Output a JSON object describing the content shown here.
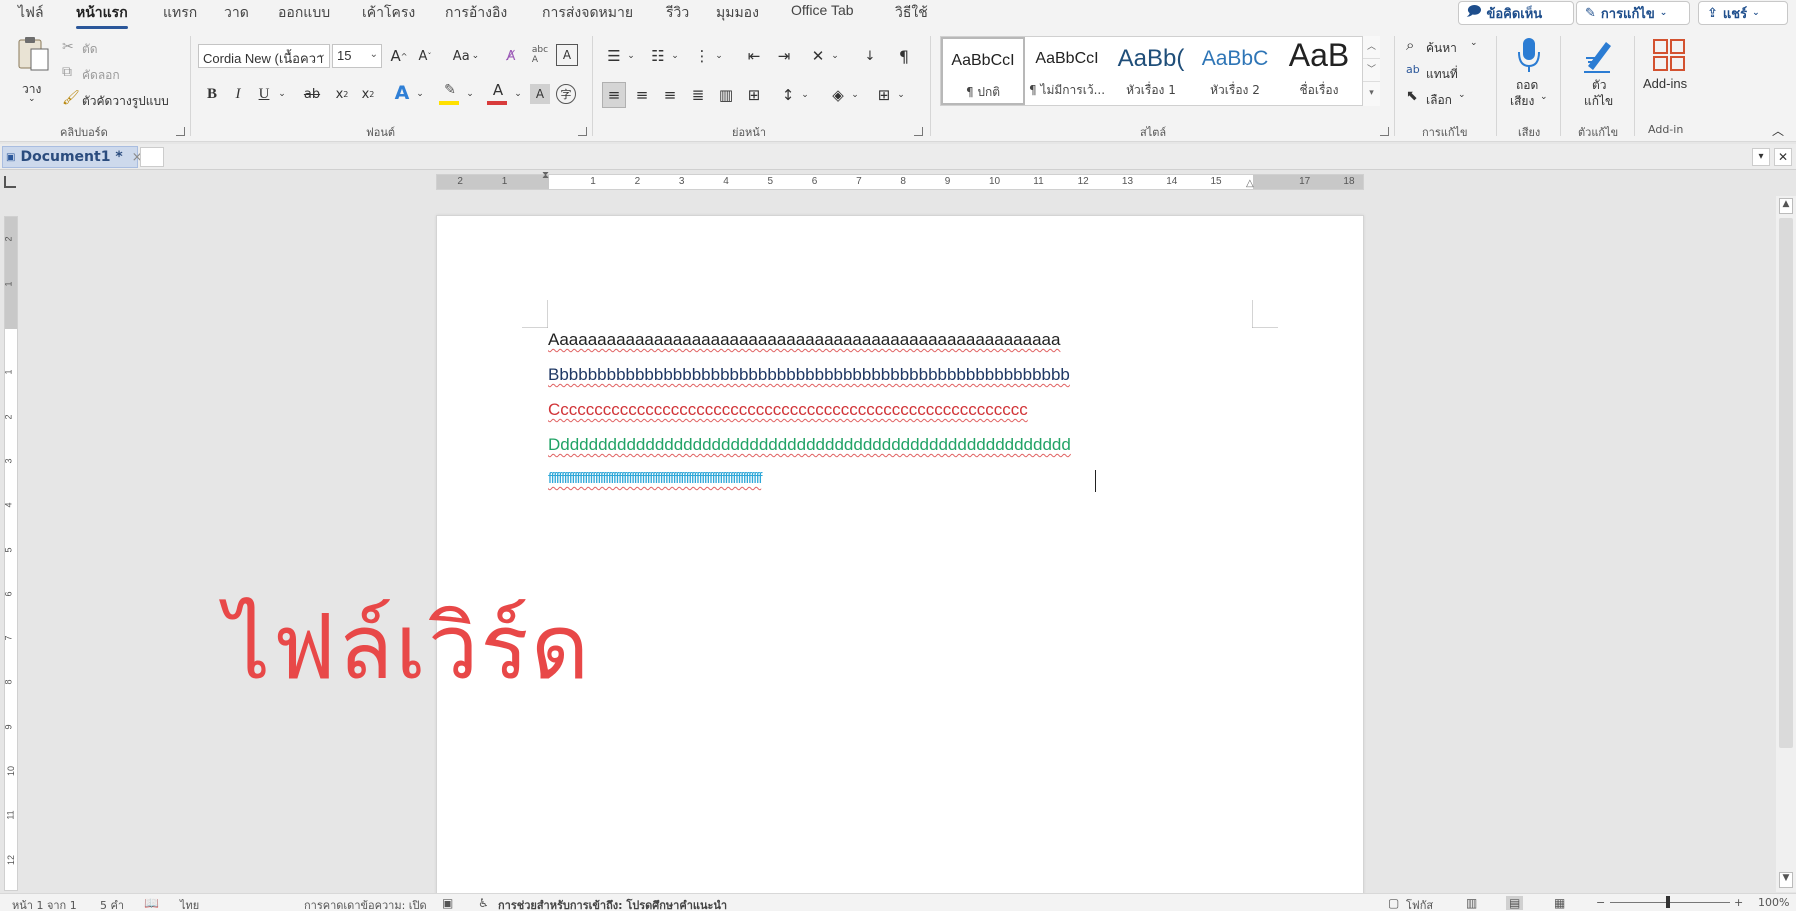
{
  "menubar": {
    "tabs": [
      "ไฟล์",
      "หน้าแรก",
      "แทรก",
      "วาด",
      "ออกแบบ",
      "เค้าโครง",
      "การอ้างอิง",
      "การส่งจดหมาย",
      "รีวิว",
      "มุมมอง",
      "Office Tab",
      "วิธีใช้"
    ],
    "active_tab": "หน้าแรก",
    "comments_label": "ข้อคิดเห็น",
    "editing_label": "การแก้ไข",
    "share_label": "แชร์"
  },
  "clipboard": {
    "paste_label": "วาง",
    "cut_label": "ตัด",
    "copy_label": "คัดลอก",
    "format_painter_label": "ตัวคัดวางรูปแบบ",
    "group_label": "คลิปบอร์ด"
  },
  "font": {
    "family": "Cordia New (เนื้อควา",
    "size": "15",
    "change_case_label": "Aa",
    "group_label": "ฟอนต์",
    "highlight_color": "#ffe000",
    "font_color": "#d83b3b"
  },
  "paragraph": {
    "group_label": "ย่อหน้า"
  },
  "styles": {
    "items": [
      {
        "preview": "AaBbCcI",
        "name": "¶ ปกติ"
      },
      {
        "preview": "AaBbCcI",
        "name": "¶ ไม่มีการเว้..."
      },
      {
        "preview": "AaBb(",
        "name": "หัวเรื่อง 1"
      },
      {
        "preview": "AaBbC",
        "name": "หัวเรื่อง 2"
      },
      {
        "preview": "AaB",
        "name": "ชื่อเรื่อง"
      }
    ],
    "group_label": "สไตล์"
  },
  "editing": {
    "find_label": "ค้นหา",
    "replace_label": "แทนที่",
    "select_label": "เลือก",
    "group_label": "การแก้ไข"
  },
  "voice": {
    "dictate_label_1": "ถอด",
    "dictate_label_2": "เสียง",
    "group_label": "เสียง"
  },
  "editor": {
    "label_1": "ตัว",
    "label_2": "แก้ไข",
    "group_label": "ตัวแก้ไข"
  },
  "addins": {
    "button_label": "Add-ins",
    "group_label": "Add-in"
  },
  "document_tabs": {
    "active_title": "Document1 *"
  },
  "document": {
    "lines": [
      {
        "text": "Aaaaaaaaaaaaaaaaaaaaaaaaaaaaaaaaaaaaaaaaaaaaaaaaaaaaaa",
        "color": "#222222"
      },
      {
        "text": "Bbbbbbbbbbbbbbbbbbbbbbbbbbbbbbbbbbbbbbbbbbbbbbbbbbbbbbb",
        "color": "#1f3864"
      },
      {
        "text": "Cccccccccccccccccccccccccccccccccccccccccccccccccccccccc",
        "color": "#d13438"
      },
      {
        "text": "Ddddddddddddddddddddddddddddddddddddddddddddddddddddddd",
        "color": "#21a366"
      },
      {
        "text": "ffffffffffffffffffffffffffffffffffffffffffffffffffffffffffffffffffffffffffffffffff",
        "color": "#2ea7d8"
      }
    ],
    "overlay_text": "ไฟล์เวิร์ด",
    "overlay_color": "#e84848"
  },
  "status": {
    "page": "หน้า 1 จาก 1",
    "words": "5 คำ",
    "language": "ไทย",
    "text_predictions": "การคาดเดาข้อความ: เปิด",
    "accessibility": "การช่วยสำหรับการเข้าถึง: โปรดศึกษาคำแนะนำ",
    "focus": "โฟกัส",
    "zoom": "100%"
  }
}
